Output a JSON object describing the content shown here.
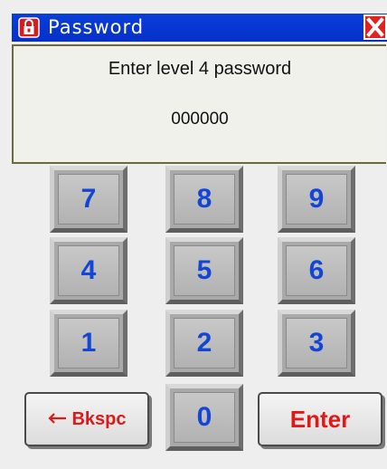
{
  "window": {
    "title": "Password",
    "title_icon": "lock-icon",
    "close_icon": "close-icon"
  },
  "display": {
    "prompt_prefix": "Enter level",
    "level": "4",
    "prompt_suffix": "password",
    "entry": "000000"
  },
  "keypad": {
    "keys": [
      "7",
      "8",
      "9",
      "4",
      "5",
      "6",
      "1",
      "2",
      "3",
      "0"
    ],
    "backspace_label": "Bkspc",
    "backspace_icon": "arrow-left-icon",
    "enter_label": "Enter"
  },
  "colors": {
    "titlebar": "#0530c8",
    "digit": "#1345d6",
    "function_key_text": "#e01818"
  }
}
